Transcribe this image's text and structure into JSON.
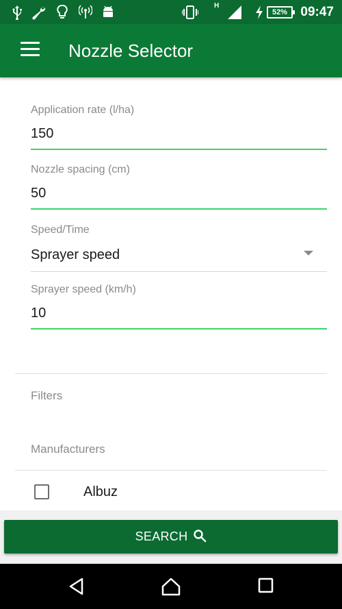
{
  "status_bar": {
    "battery": "52%",
    "time": "09:47",
    "network_type": "H",
    "icons": [
      "usb-icon",
      "wrench-icon",
      "bulb-icon",
      "hotspot-icon",
      "android-icon",
      "vibrate-icon",
      "signal-icon",
      "charging-icon",
      "battery-icon"
    ]
  },
  "app_bar": {
    "title": "Nozzle Selector",
    "menu_icon": "menu-icon"
  },
  "form": {
    "application_rate": {
      "label": "Application rate (l/ha)",
      "value": "150"
    },
    "nozzle_spacing": {
      "label": "Nozzle spacing (cm)",
      "value": "50"
    },
    "speed_time": {
      "label": "Speed/Time",
      "selected": "Sprayer speed"
    },
    "sprayer_speed": {
      "label": "Sprayer speed (km/h)",
      "value": "10"
    }
  },
  "filters": {
    "title": "Filters",
    "manufacturers_label": "Manufacturers",
    "manufacturers": [
      {
        "name": "Albuz",
        "checked": false
      }
    ]
  },
  "search_button": {
    "label": "SEARCH",
    "icon": "search-icon"
  },
  "colors": {
    "primary": "#0b7a36",
    "primary_dark": "#0b6b31",
    "accent": "#3fd26a"
  }
}
